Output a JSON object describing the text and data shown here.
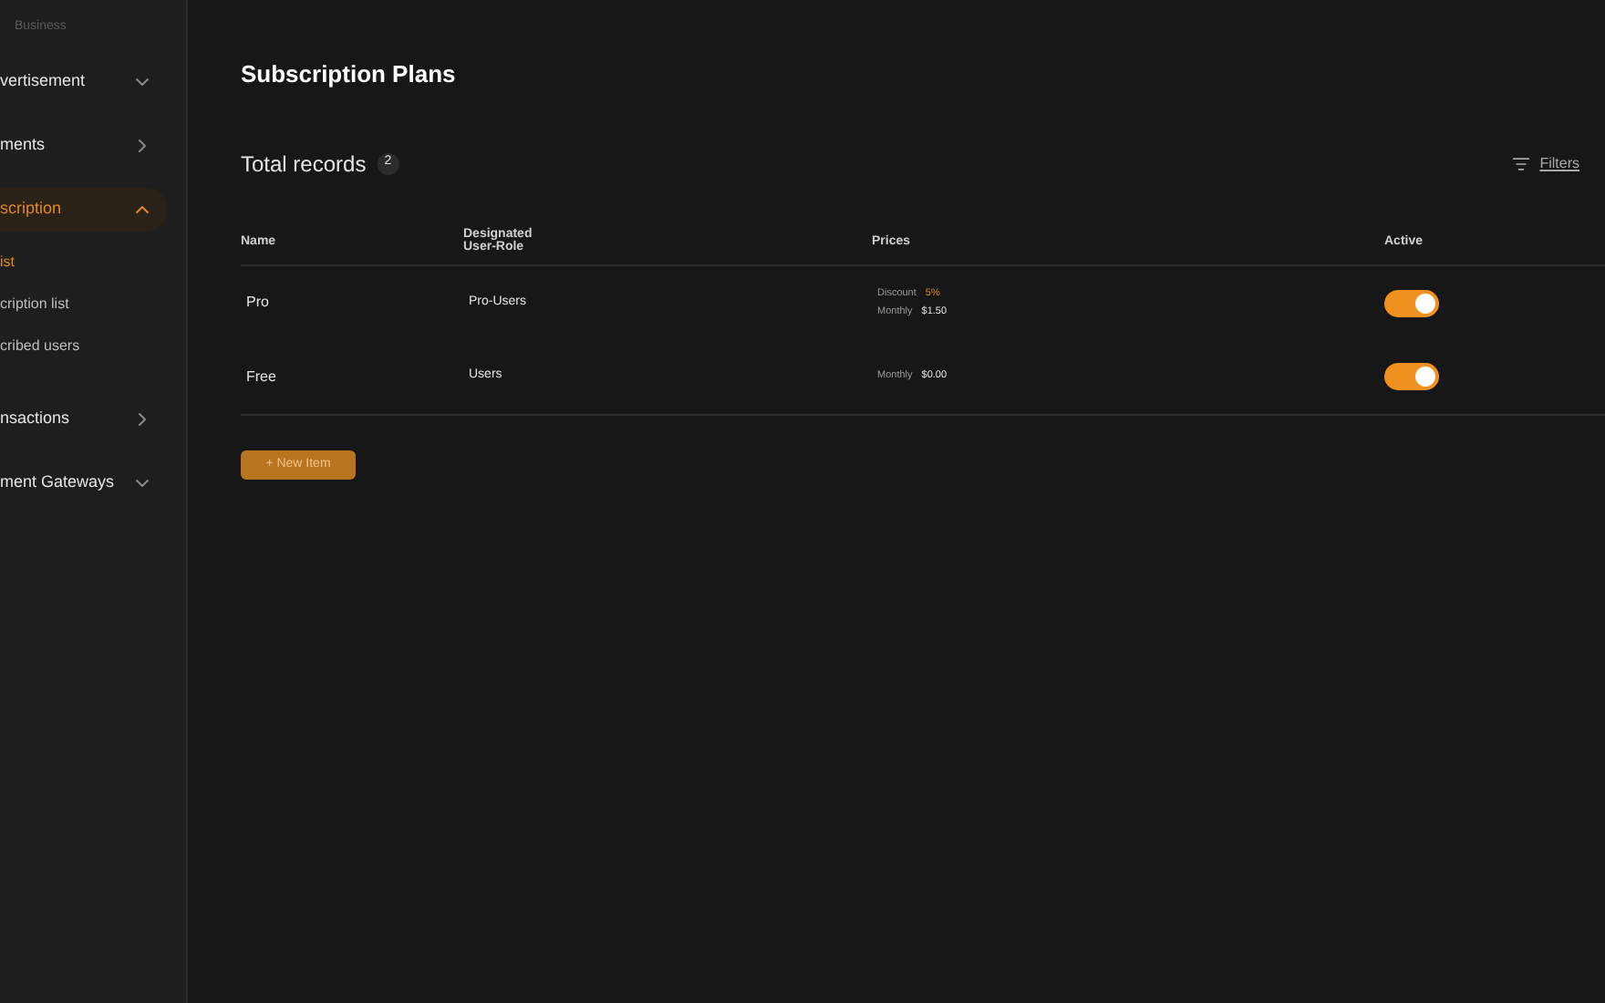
{
  "sidebar": {
    "section_label": "Business",
    "items": [
      {
        "label": "vertisement",
        "selected": false,
        "kind": "down"
      },
      {
        "label": "ments",
        "selected": false,
        "kind": "right"
      },
      {
        "label": "scription",
        "selected": true,
        "kind": "up",
        "children": [
          {
            "label": "ist",
            "selected": true
          },
          {
            "label": "cription list",
            "selected": false
          },
          {
            "label": "cribed users",
            "selected": false
          }
        ]
      },
      {
        "label": "nsactions",
        "selected": false,
        "kind": "right"
      },
      {
        "label": "ment Gateways",
        "selected": false,
        "kind": "down"
      }
    ]
  },
  "page_title": "Subscription Plans",
  "records": {
    "label": "Total records",
    "count": "2",
    "filters": "Filters"
  },
  "table": {
    "columns": [
      "Name",
      "Designated User-Role",
      "Prices",
      "Active"
    ],
    "rows": [
      {
        "name": "Pro",
        "role": "Pro-Users",
        "prices": [
          {
            "label": "Discount",
            "value": "5%",
            "accent": true
          },
          {
            "label": "Monthly",
            "value": "$1.50",
            "accent": false
          }
        ],
        "active": true
      },
      {
        "name": "Free",
        "role": "Users",
        "prices": [
          {
            "label": "Monthly",
            "value": "$0.00",
            "accent": false
          }
        ],
        "active": true
      }
    ]
  },
  "new_button": "+ New Item"
}
